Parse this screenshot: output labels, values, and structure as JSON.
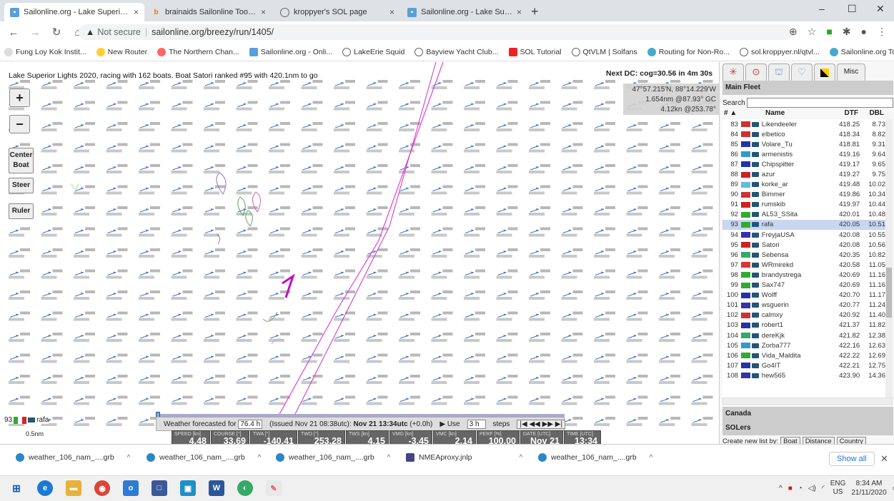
{
  "browser": {
    "tabs": [
      {
        "label": "Sailonline.org - Lake Superior Li",
        "close": "×"
      },
      {
        "label": "brainaids Sailonline Toolbox",
        "close": "×"
      },
      {
        "label": "kroppyer's SOL page",
        "close": "×"
      },
      {
        "label": "Sailonline.org - Lake Superior Li",
        "close": "×"
      }
    ],
    "new_tab": "+",
    "win_min": "–",
    "win_max": "☐",
    "win_close": "✕",
    "not_secure": "Not secure",
    "url": "sailonline.org/breezy/run/1405/",
    "bookmarks": [
      "Fung Loy Kok Instit...",
      "New Router",
      "The Northern Chan...",
      "Sailonline.org - Onli...",
      "LakeErie Squid",
      "Bayview Yacht Club...",
      "SOL Tutorial",
      "QtVLM | Solfans",
      "Routing for Non-Ro...",
      "sol.kroppyer.nl/qtvl...",
      "Sailonline.org Tools..."
    ]
  },
  "map": {
    "race_title": "Lake Superior Lights 2020, racing with 162 boats. Boat Satori ranked #95 with 420.1nm to go",
    "next_dc": "Next DC: cog=30.56 in 4m 30s",
    "pos_line1": "47°57.215'N, 88°14.229'W",
    "pos_line2": "1.654nm @87.93° GC",
    "pos_line3": "4.12kn @253.78°",
    "zoom_in": "+",
    "zoom_out": "−",
    "center_boat_1": "Center",
    "center_boat_2": "Boat",
    "steer": "Steer",
    "ruler": "Ruler",
    "boat_rank": "93",
    "boat_name": "rafa",
    "scale_label": "0.5nm",
    "weather": {
      "forecast_prefix": "Weather forecasted for",
      "hours": "76.4 h",
      "issued": "(Issued Nov 21 08:38utc):",
      "time": "Nov 21 13:34utc",
      "offset": "(+0.0h)",
      "use_label": "▶ Use",
      "use_value": "3 h",
      "steps_label": "steps",
      "nav": "|◀ ◀◀ ▶▶ ▶|"
    },
    "instruments": [
      {
        "label": "SPEED [kn]",
        "value": "4.48",
        "w": 54
      },
      {
        "label": "COURSE [°]",
        "value": "33.69",
        "w": 54
      },
      {
        "label": "TWA [°]",
        "value": "-140.41",
        "w": 66
      },
      {
        "label": "TWD [°]",
        "value": "253.28",
        "w": 66
      },
      {
        "label": "TWS [kn]",
        "value": "4.15",
        "w": 60
      },
      {
        "label": "VMG [kn]",
        "value": "-3.45",
        "w": 60
      },
      {
        "label": "VMC [kn]",
        "value": "2.14",
        "w": 60
      },
      {
        "label": "PERF [%]",
        "value": "100.00",
        "w": 60
      },
      {
        "label": "DATE [UTC]",
        "value": "Nov 21",
        "w": 60
      },
      {
        "label": "TIME [UTC]",
        "value": "13:34",
        "w": 52
      }
    ]
  },
  "panel": {
    "tab_misc": "Misc",
    "main_fleet": "Main Fleet",
    "search_label": "Search",
    "col_rank": "# ▲",
    "col_name": "Name",
    "col_dtf": "DTF",
    "col_dbl": "DBL",
    "fleet": [
      {
        "rank": "83",
        "name": "Likendeeler",
        "dtf": "418.25",
        "dbl": "8.73",
        "flag": "#c33"
      },
      {
        "rank": "84",
        "name": "elbetico",
        "dtf": "418.34",
        "dbl": "8.82",
        "flag": "#c33"
      },
      {
        "rank": "85",
        "name": "Volare_Tu",
        "dtf": "418.81",
        "dbl": "9.31",
        "flag": "#23a"
      },
      {
        "rank": "86",
        "name": "armenistis",
        "dtf": "419.16",
        "dbl": "9.64",
        "flag": "#39c"
      },
      {
        "rank": "87",
        "name": "Chipspitter",
        "dtf": "419.17",
        "dbl": "9.65",
        "flag": "#23a"
      },
      {
        "rank": "88",
        "name": "azur",
        "dtf": "419.27",
        "dbl": "9.75",
        "flag": "#c22"
      },
      {
        "rank": "89",
        "name": "korke_ar",
        "dtf": "419.48",
        "dbl": "10.02",
        "flag": "#6bd"
      },
      {
        "rank": "90",
        "name": "Bimmer",
        "dtf": "419.86",
        "dbl": "10.34",
        "flag": "#c33"
      },
      {
        "rank": "91",
        "name": "rumskib",
        "dtf": "419.97",
        "dbl": "10.44",
        "flag": "#c22"
      },
      {
        "rank": "92",
        "name": "AL53_SSita",
        "dtf": "420.01",
        "dbl": "10.48",
        "flag": "#3a3"
      },
      {
        "rank": "93",
        "name": "rafa",
        "dtf": "420.05",
        "dbl": "10.51",
        "flag": "#3a3"
      },
      {
        "rank": "94",
        "name": "FreyjaUSA",
        "dtf": "420.08",
        "dbl": "10.55",
        "flag": "#33a"
      },
      {
        "rank": "95",
        "name": "Satori",
        "dtf": "420.08",
        "dbl": "10.56",
        "flag": "#c22"
      },
      {
        "rank": "96",
        "name": "Sebensa",
        "dtf": "420.35",
        "dbl": "10.82",
        "flag": "#3a6"
      },
      {
        "rank": "97",
        "name": "WRmirekd",
        "dtf": "420.58",
        "dbl": "11.05",
        "flag": "#d33"
      },
      {
        "rank": "98",
        "name": "brandystrega",
        "dtf": "420.69",
        "dbl": "11.16",
        "flag": "#3a3"
      },
      {
        "rank": "99",
        "name": "Sax747",
        "dtf": "420.69",
        "dbl": "11.16",
        "flag": "#3a3"
      },
      {
        "rank": "100",
        "name": "Wolff",
        "dtf": "420.70",
        "dbl": "11.17",
        "flag": "#23a"
      },
      {
        "rank": "101",
        "name": "wsguerin",
        "dtf": "420.77",
        "dbl": "11.24",
        "flag": "#33a"
      },
      {
        "rank": "102",
        "name": "calmxy",
        "dtf": "420.92",
        "dbl": "11.40",
        "flag": "#c33"
      },
      {
        "rank": "103",
        "name": "robert1",
        "dtf": "421.37",
        "dbl": "11.82",
        "flag": "#23a"
      },
      {
        "rank": "104",
        "name": "dereKjk",
        "dtf": "421.82",
        "dbl": "12.38",
        "flag": "#3a6"
      },
      {
        "rank": "105",
        "name": "Zorba777",
        "dtf": "422.16",
        "dbl": "12.63",
        "flag": "#39c"
      },
      {
        "rank": "106",
        "name": "Vida_Maldita",
        "dtf": "422.22",
        "dbl": "12.69",
        "flag": "#3a3"
      },
      {
        "rank": "107",
        "name": "Go4IT",
        "dtf": "422.21",
        "dbl": "12.75",
        "flag": "#23a"
      },
      {
        "rank": "108",
        "name": "hew565",
        "dtf": "423.90",
        "dbl": "14.36",
        "flag": "#33a"
      }
    ],
    "canada": "Canada",
    "solers": "SOLers",
    "create_label": "Create new list by:",
    "create_boat": "Boat",
    "create_distance": "Distance",
    "create_country": "Country"
  },
  "downloads": {
    "items": [
      "weather_106_nam_....grb",
      "weather_106_nam_....grb",
      "weather_106_nam_....grb",
      "NMEAproxy.jnlp",
      "weather_106_nam_....grb"
    ],
    "show_all": "Show all",
    "close": "✕"
  },
  "taskbar": {
    "lang": "ENG",
    "region": "US",
    "time": "8:34 AM",
    "date": "21/11/2020"
  }
}
